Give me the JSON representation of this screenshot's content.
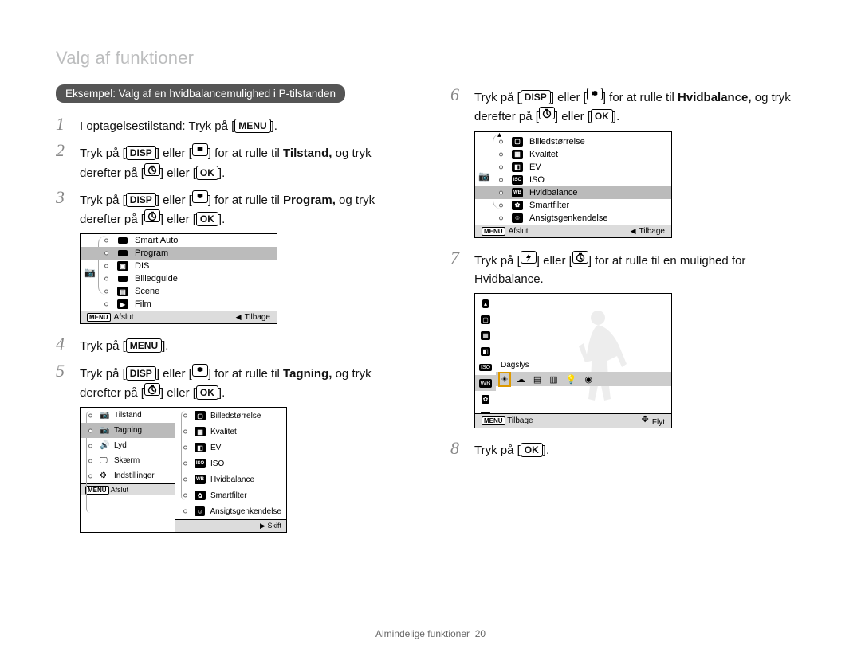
{
  "page_title": "Valg af funktioner",
  "banner": "Eksempel: Valg af en hvidbalancemulighed i P-tilstanden",
  "buttons": {
    "menu": "MENU",
    "disp": "DISP",
    "ok": "OK"
  },
  "steps": {
    "1": {
      "pre": "I optagelsestilstand: Tryk på [",
      "post": "]."
    },
    "2": {
      "a": "Tryk på [",
      "b": "] eller [",
      "c": "] for at rulle til ",
      "target": "Tilstand,",
      "d": " og tryk derefter på [",
      "e": "] eller [",
      "f": "]."
    },
    "3": {
      "a": "Tryk på [",
      "b": "] eller [",
      "c": "] for at rulle til ",
      "target": "Program,",
      "d": " og tryk derefter på [",
      "e": "] eller [",
      "f": "]."
    },
    "4": {
      "a": "Tryk på [",
      "b": "]."
    },
    "5": {
      "a": "Tryk på [",
      "b": "] eller [",
      "c": "] for at rulle til ",
      "target": "Tagning,",
      "d": " og tryk derefter på [",
      "e": "] eller [",
      "f": "]."
    },
    "6": {
      "a": "Tryk på [",
      "b": "] eller [",
      "c": "] for at rulle til ",
      "target": "Hvidbalance,",
      "d": " og tryk derefter på [",
      "e": "] eller [",
      "f": "]."
    },
    "7": {
      "a": "Tryk på [",
      "b": "] eller [",
      "c": "] for at rulle til en mulighed for Hvidbalance."
    },
    "8": {
      "a": "Tryk på [",
      "b": "]."
    }
  },
  "shot1": {
    "items": [
      "Smart Auto",
      "Program",
      "DIS",
      "Billedguide",
      "Scene",
      "Film"
    ],
    "selected_index": 1,
    "footer_left": "Afslut",
    "footer_right": "Tilbage"
  },
  "shot2": {
    "left_items": [
      "Tilstand",
      "Tagning",
      "Lyd",
      "Skærm",
      "Indstillinger"
    ],
    "left_selected_index": 1,
    "right_items": [
      "Billedstørrelse",
      "Kvalitet",
      "EV",
      "ISO",
      "Hvidbalance",
      "Smartfilter",
      "Ansigtsgenkendelse"
    ],
    "footer_left": "Afslut",
    "footer_right": "Skift"
  },
  "shot3": {
    "items": [
      "Billedstørrelse",
      "Kvalitet",
      "EV",
      "ISO",
      "Hvidbalance",
      "Smartfilter",
      "Ansigtsgenkendelse"
    ],
    "selected_index": 4,
    "footer_left": "Afslut",
    "footer_right": "Tilbage"
  },
  "shot4": {
    "label": "Dagslys",
    "footer_left": "Tilbage",
    "footer_right": "Flyt"
  },
  "footer": {
    "section": "Almindelige funktioner",
    "page": "20"
  }
}
